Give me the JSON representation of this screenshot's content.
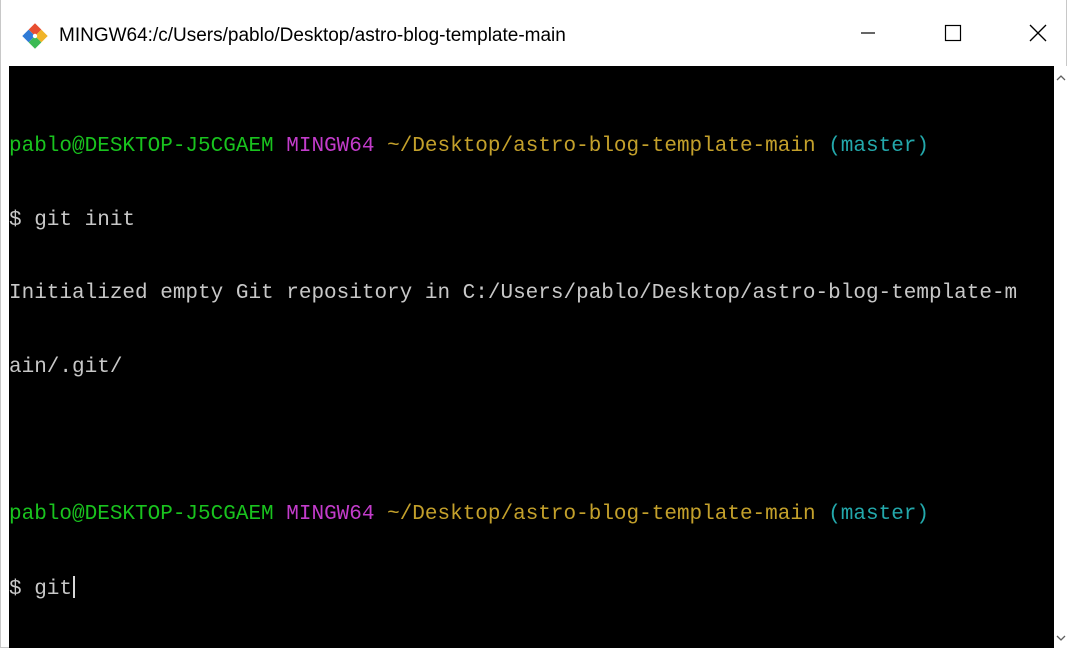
{
  "window": {
    "title": "MINGW64:/c/Users/pablo/Desktop/astro-blog-template-main",
    "icon": "git-icon",
    "controls": {
      "minimize_icon": "minimize-icon",
      "maximize_icon": "maximize-icon",
      "close_icon": "close-icon"
    }
  },
  "terminal": {
    "prompt1": {
      "user_host": "pablo@DESKTOP-J5CGAEM",
      "env": "MINGW64",
      "path": "~/Desktop/astro-blog-template-main",
      "branch": "(master)"
    },
    "command1": "$ git init",
    "output": [
      "Initialized empty Git repository in C:/Users/pablo/Desktop/astro-blog-template-m",
      "ain/.git/"
    ],
    "prompt2": {
      "user_host": "pablo@DESKTOP-J5CGAEM",
      "env": "MINGW64",
      "path": "~/Desktop/astro-blog-template-main",
      "branch": "(master)"
    },
    "current_input": "$ git"
  },
  "colors": {
    "background": "#000000",
    "user_host": "#19c31e",
    "env": "#c33ccb",
    "path": "#c3a02b",
    "branch": "#23a8ab",
    "text": "#c8c8c8",
    "git_icon_orange": "#e84e31",
    "git_icon_blue": "#2f7bd6"
  }
}
